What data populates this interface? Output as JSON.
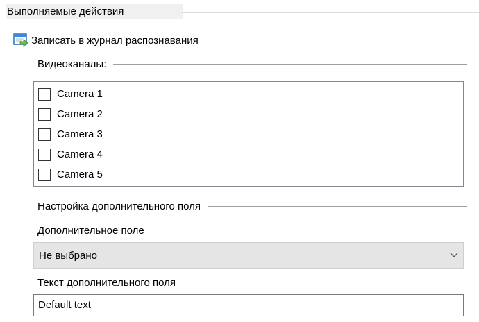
{
  "group": {
    "title": "Выполняемые действия"
  },
  "action": {
    "label": "Записать в журнал распознавания",
    "icon": "log-action-icon"
  },
  "channels": {
    "header": "Видеоканалы:",
    "items": [
      {
        "label": "Camera 1",
        "checked": false
      },
      {
        "label": "Camera 2",
        "checked": false
      },
      {
        "label": "Camera 3",
        "checked": false
      },
      {
        "label": "Camera 4",
        "checked": false
      },
      {
        "label": "Camera 5",
        "checked": false
      }
    ]
  },
  "extra": {
    "header": "Настройка дополнительного поля",
    "field_label": "Дополнительное поле",
    "field_value": "Не выбрано",
    "text_label": "Текст дополнительного поля",
    "text_value": "Default text"
  }
}
